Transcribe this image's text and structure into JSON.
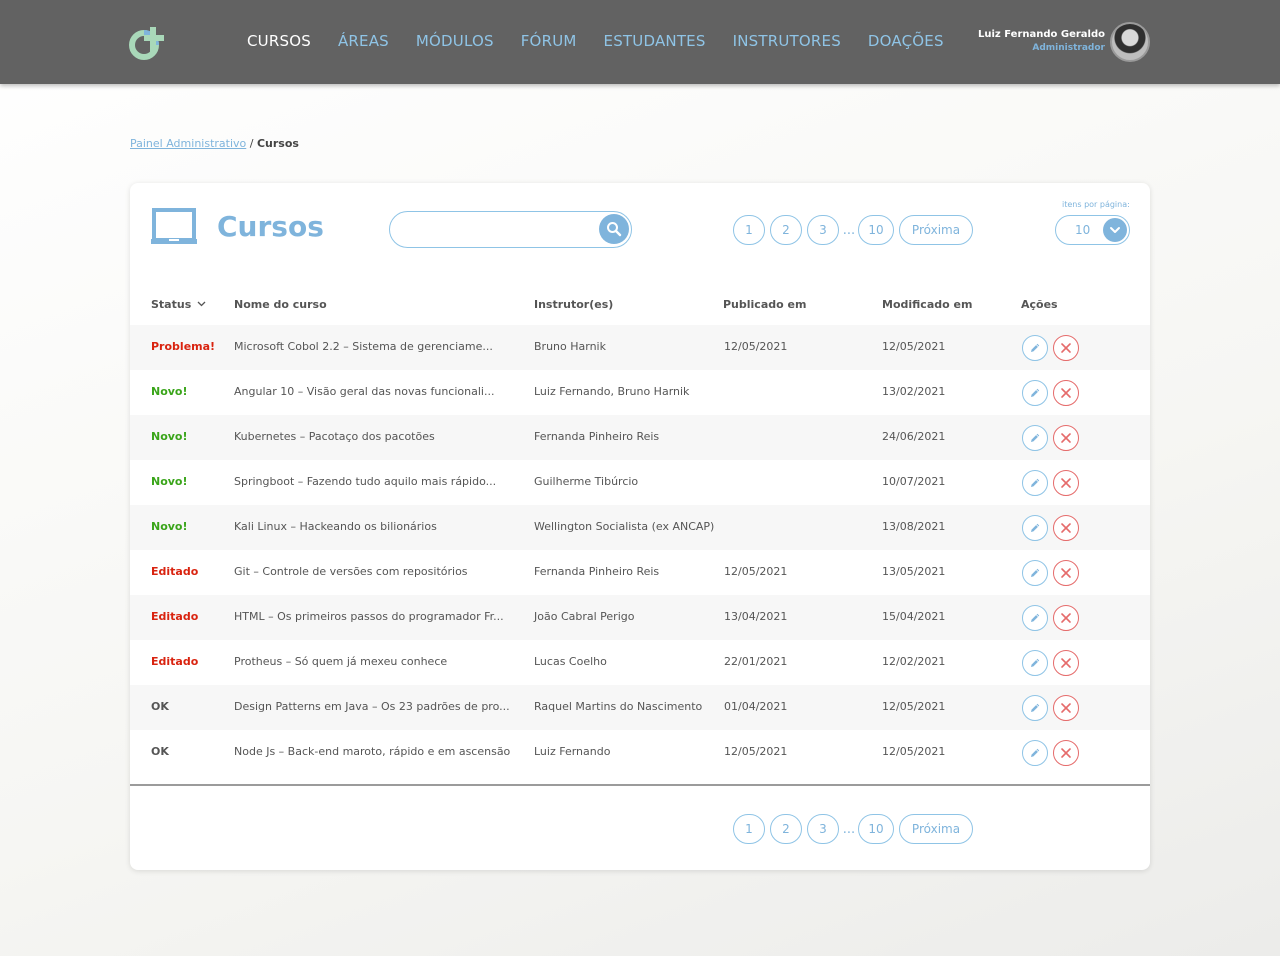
{
  "nav": {
    "items": [
      {
        "label": "CURSOS",
        "active": true
      },
      {
        "label": "ÁREAS",
        "active": false
      },
      {
        "label": "MÓDULOS",
        "active": false
      },
      {
        "label": "FÓRUM",
        "active": false
      },
      {
        "label": "ESTUDANTES",
        "active": false
      },
      {
        "label": "INSTRUTORES",
        "active": false
      },
      {
        "label": "DOAÇÕES",
        "active": false
      }
    ]
  },
  "user": {
    "name": "Luiz Fernando Geraldo",
    "role": "Administrador"
  },
  "breadcrumb": {
    "parent": "Painel Administrativo",
    "separator": " / ",
    "current": "Cursos"
  },
  "page": {
    "title": "Cursos",
    "search_value": "",
    "items_per_page_label": "itens por página:",
    "items_per_page": "10"
  },
  "pagination": {
    "pages": [
      "1",
      "2",
      "3"
    ],
    "ellipsis": "...",
    "last": "10",
    "next": "Próxima"
  },
  "table": {
    "headers": {
      "status": "Status",
      "name": "Nome do curso",
      "instructors": "Instrutor(es)",
      "published": "Publicado em",
      "modified": "Modificado em",
      "actions": "Ações"
    },
    "rows": [
      {
        "status": "Problema!",
        "status_color": "#d9230f",
        "name": "Microsoft Cobol 2.2 – Sistema de gerenciame...",
        "instructors": "Bruno Harnik",
        "published": "12/05/2021",
        "modified": "12/05/2021"
      },
      {
        "status": "Novo!",
        "status_color": "#3aa51a",
        "name": "Angular 10 – Visão geral das novas funcionali...",
        "instructors": "Luiz Fernando, Bruno Harnik",
        "published": "",
        "modified": "13/02/2021"
      },
      {
        "status": "Novo!",
        "status_color": "#3aa51a",
        "name": "Kubernetes – Pacotaço dos pacotões",
        "instructors": "Fernanda Pinheiro Reis",
        "published": "",
        "modified": "24/06/2021"
      },
      {
        "status": "Novo!",
        "status_color": "#3aa51a",
        "name": "Springboot – Fazendo tudo aquilo mais rápido...",
        "instructors": "Guilherme Tibúrcio",
        "published": "",
        "modified": "10/07/2021"
      },
      {
        "status": "Novo!",
        "status_color": "#3aa51a",
        "name": "Kali Linux – Hackeando os bilionários",
        "instructors": "Wellington Socialista (ex ANCAP)",
        "published": "",
        "modified": "13/08/2021"
      },
      {
        "status": "Editado",
        "status_color": "#d9230f",
        "name": "Git – Controle de versões com repositórios",
        "instructors": "Fernanda Pinheiro Reis",
        "published": "12/05/2021",
        "modified": "13/05/2021"
      },
      {
        "status": "Editado",
        "status_color": "#d9230f",
        "name": "HTML – Os primeiros passos do programador Fr...",
        "instructors": "João Cabral Perigo",
        "published": "13/04/2021",
        "modified": "15/04/2021"
      },
      {
        "status": "Editado",
        "status_color": "#d9230f",
        "name": "Protheus – Só quem já mexeu conhece",
        "instructors": "Lucas Coelho",
        "published": "22/01/2021",
        "modified": "12/02/2021"
      },
      {
        "status": "OK",
        "status_color": "#555555",
        "name": "Design Patterns em Java – Os 23 padrões de pro...",
        "instructors": "Raquel Martins do Nascimento",
        "published": "01/04/2021",
        "modified": "12/05/2021"
      },
      {
        "status": "OK",
        "status_color": "#555555",
        "name": "Node Js – Back-end maroto, rápido e em ascensão",
        "instructors": "Luiz Fernando",
        "published": "12/05/2021",
        "modified": "12/05/2021"
      }
    ]
  },
  "icons": {
    "logo": "logo-icon",
    "avatar": "avatar",
    "search": "search-icon",
    "monitor": "monitor-icon",
    "chevron": "chevron-down-icon",
    "edit": "pencil-icon",
    "delete": "close-icon"
  },
  "colors": {
    "topbar": "#626262",
    "accent": "#7fb4dc",
    "danger": "#e56b6b",
    "status_problem": "#d9230f",
    "status_new": "#3aa51a"
  }
}
